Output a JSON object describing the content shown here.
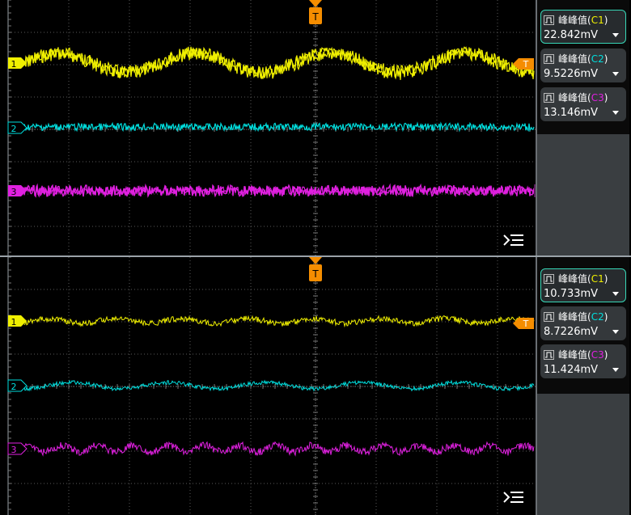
{
  "colors": {
    "c1": "#f0f000",
    "c2": "#00dede",
    "c3": "#e020e0",
    "trigger": "#f58d00",
    "grid": "#5a5a5a",
    "active_border": "#37d6b6"
  },
  "markers": {
    "ch1": "1",
    "ch2": "2",
    "ch3": "3",
    "trigger": "T"
  },
  "panels": [
    {
      "measurements": [
        {
          "label": "峰峰值",
          "source": "C1",
          "value": "22.842mV",
          "active": true
        },
        {
          "label": "峰峰值",
          "source": "C2",
          "value": "9.5226mV",
          "active": false
        },
        {
          "label": "峰峰值",
          "source": "C3",
          "value": "13.146mV",
          "active": false
        }
      ]
    },
    {
      "measurements": [
        {
          "label": "峰峰值",
          "source": "C1",
          "value": "10.733mV",
          "active": true
        },
        {
          "label": "峰峰值",
          "source": "C2",
          "value": "8.7226mV",
          "active": false
        },
        {
          "label": "峰峰值",
          "source": "C3",
          "value": "11.424mV",
          "active": false
        }
      ]
    }
  ],
  "icons": {
    "measure_type": "peak-to-peak-pulse-icon",
    "menu": "collapse-menu-icon",
    "dropdown": "chevron-down-icon"
  }
}
